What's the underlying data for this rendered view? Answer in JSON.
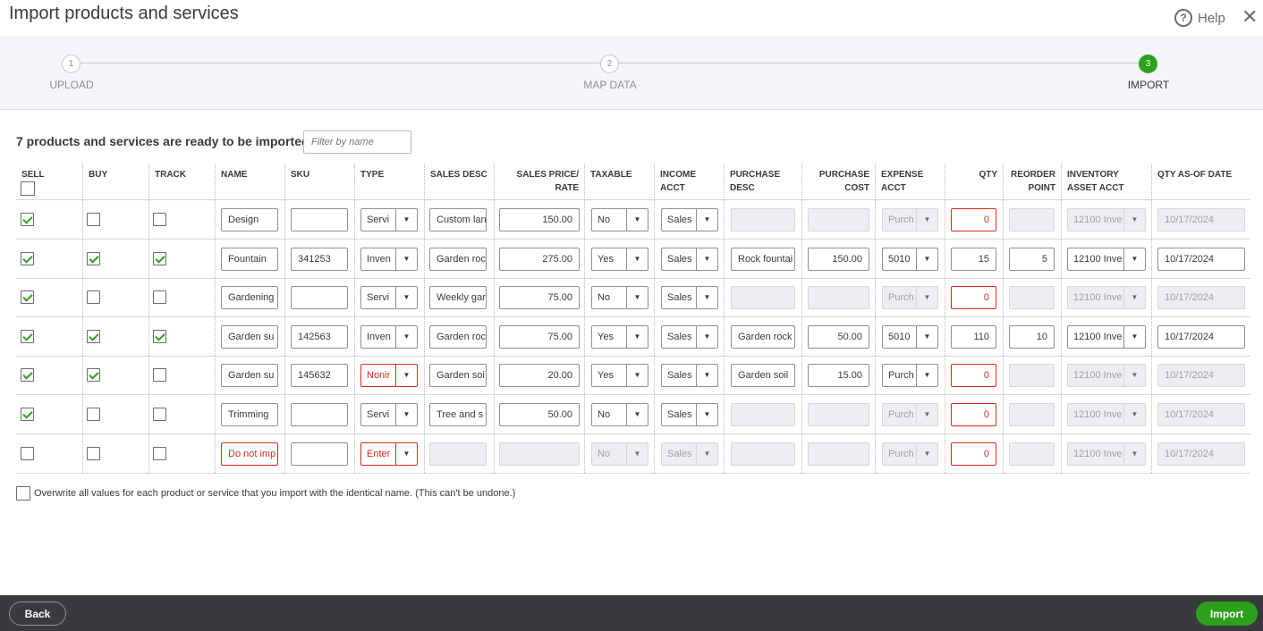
{
  "window": {
    "title": "Import products and services",
    "help_label": "Help",
    "close_symbol": "✕"
  },
  "steps": [
    {
      "number": "1",
      "label": "UPLOAD"
    },
    {
      "number": "2",
      "label": "MAP DATA"
    },
    {
      "number": "3",
      "label": "IMPORT"
    }
  ],
  "active_step": 3,
  "summary": "7 products and services are ready to be imported",
  "filter": {
    "placeholder": "Filter by name"
  },
  "columns": [
    "SELL",
    "BUY",
    "TRACK",
    "NAME",
    "SKU",
    "TYPE",
    "SALES DESC",
    "SALES PRICE/ RATE",
    "TAXABLE",
    "INCOME ACCT",
    "PURCHASE DESC",
    "PURCHASE COST",
    "EXPENSE ACCT",
    "QTY",
    "REORDER POINT",
    "INVENTORY ASSET ACCT",
    "QTY AS-OF DATE"
  ],
  "rows": [
    {
      "sell": true,
      "buy": false,
      "track": false,
      "name": "Design",
      "sku": "",
      "type": "Servi",
      "sales_desc": "Custom lan",
      "price": "150.00",
      "taxable": "No",
      "income": "Sales",
      "purchase_desc": "",
      "purchase_cost": "",
      "expense": "Purch",
      "qty": "0",
      "reorder": "",
      "asset": "12100 Inve",
      "date": "10/17/2024"
    },
    {
      "sell": true,
      "buy": true,
      "track": true,
      "name": "Fountain",
      "sku": "341253",
      "type": "Inven",
      "sales_desc": "Garden roc",
      "price": "275.00",
      "taxable": "Yes",
      "income": "Sales",
      "purchase_desc": "Rock fountai",
      "purchase_cost": "150.00",
      "expense": "5010",
      "qty": "15",
      "reorder": "5",
      "asset": "12100 Inve",
      "date": "10/17/2024"
    },
    {
      "sell": true,
      "buy": false,
      "track": false,
      "name": "Gardening",
      "sku": "",
      "type": "Servi",
      "sales_desc": "Weekly gar",
      "price": "75.00",
      "taxable": "No",
      "income": "Sales",
      "purchase_desc": "",
      "purchase_cost": "",
      "expense": "Purch",
      "qty": "0",
      "reorder": "",
      "asset": "12100 Inve",
      "date": "10/17/2024"
    },
    {
      "sell": true,
      "buy": true,
      "track": true,
      "name": "Garden su",
      "sku": "142563",
      "type": "Inven",
      "sales_desc": "Garden roc",
      "price": "75.00",
      "taxable": "Yes",
      "income": "Sales",
      "purchase_desc": "Garden rock",
      "purchase_cost": "50.00",
      "expense": "5010",
      "qty": "110",
      "reorder": "10",
      "asset": "12100 Inve",
      "date": "10/17/2024"
    },
    {
      "sell": true,
      "buy": true,
      "track": false,
      "name": "Garden su",
      "sku": "145632",
      "type": "Nonir",
      "sales_desc": "Garden soi",
      "price": "20.00",
      "taxable": "Yes",
      "income": "Sales",
      "purchase_desc": "Garden soil",
      "purchase_cost": "15.00",
      "expense": "Purch",
      "qty": "0",
      "reorder": "",
      "asset": "12100 Inve",
      "date": "10/17/2024"
    },
    {
      "sell": true,
      "buy": false,
      "track": false,
      "name": "Trimming",
      "sku": "",
      "type": "Servi",
      "sales_desc": "Tree and s",
      "price": "50.00",
      "taxable": "No",
      "income": "Sales",
      "purchase_desc": "",
      "purchase_cost": "",
      "expense": "Purch",
      "qty": "0",
      "reorder": "",
      "asset": "12100 Inve",
      "date": "10/17/2024"
    },
    {
      "sell": false,
      "buy": false,
      "track": false,
      "name": "Do not imp",
      "sku": "",
      "type": "Enter",
      "sales_desc": "",
      "price": "",
      "taxable": "No",
      "income": "Sales",
      "purchase_desc": "",
      "purchase_cost": "",
      "expense": "Purch",
      "qty": "0",
      "reorder": "",
      "asset": "12100 Inve",
      "date": "10/17/2024"
    }
  ],
  "overwrite_label": "Overwrite all values for each product or service that you import with the identical name. (This can't be undone.)",
  "footer": {
    "back_label": "Back",
    "import_label": "Import"
  },
  "colors": {
    "accent": "#2ca01c",
    "error": "#d52b1e",
    "footer_bg": "#393a3d"
  }
}
